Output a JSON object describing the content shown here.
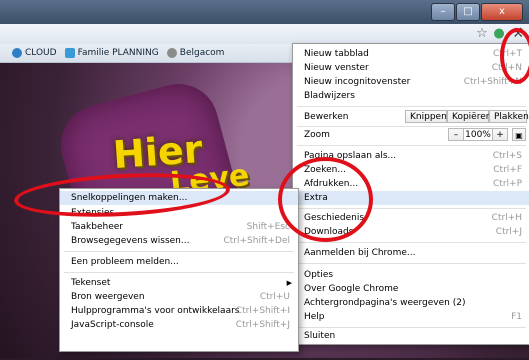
{
  "window": {
    "minimize_label": "–",
    "maximize_label": "□",
    "close_label": "x"
  },
  "toolbar": {
    "star_glyph": "☆",
    "ext_glyph": "●",
    "wrench_glyph": "⚒"
  },
  "bookmarks": [
    {
      "label": "CLOUD",
      "icon": "cloud-icon",
      "color": "#2d7fc8"
    },
    {
      "label": "Familie PLANNING",
      "icon": "puzzle-icon",
      "color": "#3a9ad9"
    },
    {
      "label": "Belgacom",
      "icon": "globe-icon",
      "color": "#8a8a8a"
    }
  ],
  "page": {
    "headline_1": "Hier",
    "headline_2": "Leve"
  },
  "main_menu": {
    "items": [
      {
        "label": "Nieuw tabblad",
        "shortcut": "Ctrl+T"
      },
      {
        "label": "Nieuw venster",
        "shortcut": "Ctrl+N"
      },
      {
        "label": "Nieuw incognitovenster",
        "shortcut": "Ctrl+Shift+N"
      },
      {
        "label": "Bladwijzers",
        "shortcut": ""
      }
    ],
    "edit": {
      "label": "Bewerken",
      "knippen": "Knippen",
      "kopieren": "Kopiëren",
      "plakken": "Plakken"
    },
    "zoom": {
      "label": "Zoom",
      "minus": "–",
      "value": "100%",
      "plus": "+"
    },
    "items2": [
      {
        "label": "Pagina opslaan als...",
        "shortcut": "Ctrl+S"
      },
      {
        "label": "Zoeken...",
        "shortcut": "Ctrl+F"
      },
      {
        "label": "Afdrukken...",
        "shortcut": "Ctrl+P"
      }
    ],
    "extra": {
      "label": "Extra"
    },
    "items3": [
      {
        "label": "Geschiedenis",
        "shortcut": "Ctrl+H"
      },
      {
        "label": "Downloads",
        "shortcut": "Ctrl+J"
      }
    ],
    "signin": {
      "label": "Aanmelden bij Chrome..."
    },
    "items4": [
      {
        "label": "Opties",
        "shortcut": ""
      },
      {
        "label": "Over Google Chrome",
        "shortcut": ""
      },
      {
        "label": "Achtergrondpagina's weergeven (2)",
        "shortcut": ""
      },
      {
        "label": "Help",
        "shortcut": "F1"
      }
    ],
    "exit": {
      "label": "Sluiten"
    }
  },
  "sub_menu": {
    "items": [
      {
        "label": "Snelkoppelingen maken...",
        "shortcut": ""
      },
      {
        "label": "Extensies",
        "shortcut": ""
      },
      {
        "label": "Taakbeheer",
        "shortcut": "Shift+Esc"
      },
      {
        "label": "Browsegegevens wissen...",
        "shortcut": "Ctrl+Shift+Del"
      }
    ],
    "report": {
      "label": "Een probleem melden..."
    },
    "items2": [
      {
        "label": "Tekenset",
        "shortcut": ""
      },
      {
        "label": "Bron weergeven",
        "shortcut": "Ctrl+U"
      },
      {
        "label": "Hulpprogramma's voor ontwikkelaars",
        "shortcut": "Ctrl+Shift+I"
      },
      {
        "label": "JavaScript-console",
        "shortcut": "Ctrl+Shift+J"
      }
    ]
  },
  "colors": {
    "annotation_red": "#e0101a",
    "menu_hover": "#dce8f7",
    "headline_yellow": "#f5d400"
  }
}
